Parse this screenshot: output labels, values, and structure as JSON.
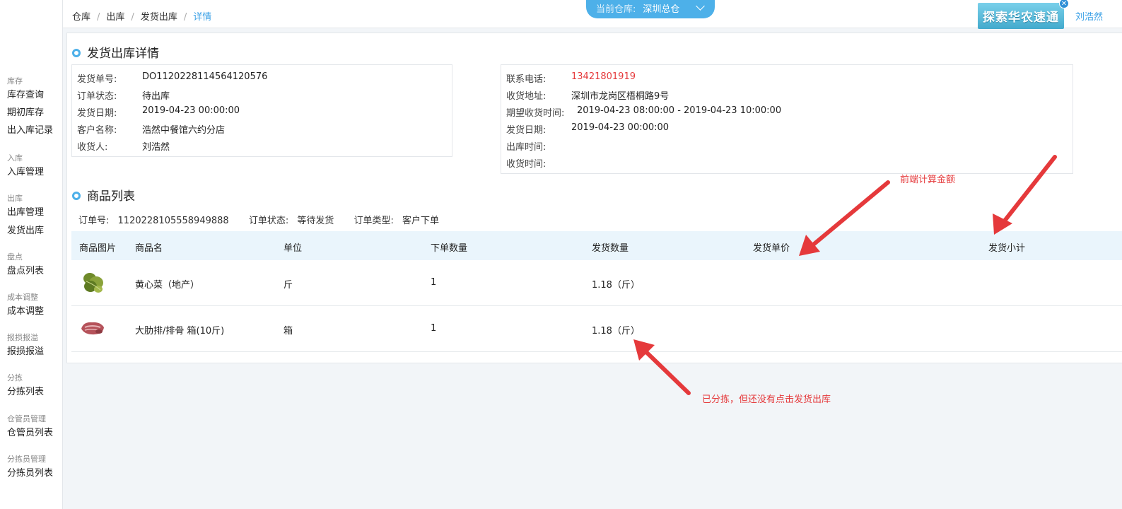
{
  "sidebar": {
    "groups": [
      {
        "title": "库存",
        "items": [
          "库存查询",
          "期初库存",
          "出入库记录"
        ]
      },
      {
        "title": "入库",
        "items": [
          "入库管理"
        ]
      },
      {
        "title": "出库",
        "items": [
          "出库管理",
          "发货出库"
        ]
      },
      {
        "title": "盘点",
        "items": [
          "盘点列表"
        ]
      },
      {
        "title": "成本调整",
        "items": [
          "成本调整"
        ]
      },
      {
        "title": "报损报溢",
        "items": [
          "报损报溢"
        ]
      },
      {
        "title": "分拣",
        "items": [
          "分拣列表"
        ]
      },
      {
        "title": "仓管员管理",
        "items": [
          "仓管员列表"
        ]
      },
      {
        "title": "分拣员管理",
        "items": [
          "分拣员列表"
        ]
      }
    ]
  },
  "header": {
    "breadcrumb": [
      "仓库",
      "出库",
      "发货出库",
      "详情"
    ],
    "warehouse_label": "当前仓库:",
    "warehouse_value": "深圳总仓",
    "ad_text": "探索华农速通",
    "ad_close": "✕",
    "user_name": "刘浩然"
  },
  "detail": {
    "title": "发货出库详情",
    "left": [
      {
        "k": "发货单号:",
        "v": "DO1120228114564120576"
      },
      {
        "k": "订单状态:",
        "v": "待出库"
      },
      {
        "k": "发货日期:",
        "v": "2019-04-23 00:00:00"
      },
      {
        "k": "客户名称:",
        "v": "浩然中餐馆六约分店"
      },
      {
        "k": "收货人:",
        "v": "刘浩然"
      }
    ],
    "right": [
      {
        "k": "联系电话:",
        "v": "13421801919"
      },
      {
        "k": "收货地址:",
        "v": "深圳市龙岗区梧桐路9号"
      },
      {
        "k": "期望收货时间:",
        "v": "2019-04-23 08:00:00 - 2019-04-23 10:00:00"
      },
      {
        "k": "发货日期:",
        "v": "2019-04-23 00:00:00"
      },
      {
        "k": "出库时间:",
        "v": ""
      },
      {
        "k": "收货时间:",
        "v": ""
      }
    ]
  },
  "products": {
    "title": "商品列表",
    "order_no_label": "订单号:",
    "order_no": "1120228105558949888",
    "status_label": "订单状态:",
    "status": "等待发货",
    "type_label": "订单类型:",
    "type": "客户下单",
    "columns": [
      "商品图片",
      "商品名",
      "单位",
      "下单数量",
      "发货数量",
      "发货单价",
      "发货小计"
    ],
    "rows": [
      {
        "image": "vegetable-image",
        "name": "黄心菜（地产）",
        "unit": "斤",
        "order_qty": "1",
        "ship_qty": "1.18（斤）",
        "price": "",
        "subtotal": ""
      },
      {
        "image": "meat-image",
        "name": "大肋排/排骨 箱(10斤)",
        "unit": "箱",
        "order_qty": "1",
        "ship_qty": "1.18（斤）",
        "price": "",
        "subtotal": ""
      }
    ]
  },
  "annotations": {
    "frontend_calc": "前端计算金额",
    "sorted_note": "已分拣，但还没有点击发货出库"
  },
  "colors": {
    "accent": "#4db0e9",
    "link": "#3aa0e6",
    "red": "#e5393b"
  }
}
